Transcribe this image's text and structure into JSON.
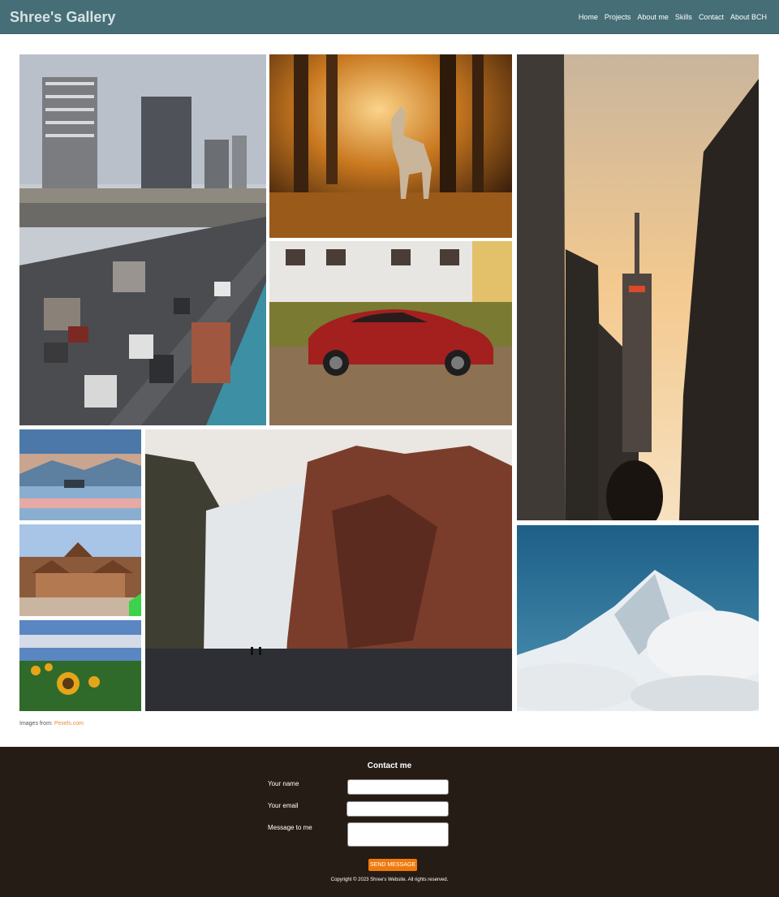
{
  "header": {
    "brand": "Shree's Gallery",
    "nav": [
      "Home",
      "Projects",
      "About me",
      "Skills",
      "Contact",
      "About BCH"
    ]
  },
  "gallery": {
    "images": [
      {
        "subject": "highway-traffic",
        "icon": "city-highway-photo"
      },
      {
        "subject": "horse-forest",
        "icon": "horse-photo"
      },
      {
        "subject": "red-car",
        "icon": "car-photo"
      },
      {
        "subject": "tower-street",
        "icon": "tower-photo"
      },
      {
        "subject": "lake-sunset",
        "icon": "lake-photo"
      },
      {
        "subject": "temples",
        "icon": "temple-photo"
      },
      {
        "subject": "sunflowers",
        "icon": "sunflower-photo"
      },
      {
        "subject": "waterfall",
        "icon": "waterfall-photo"
      },
      {
        "subject": "snowy-mountain",
        "icon": "mountain-photo"
      }
    ],
    "credit_prefix": "Images from:",
    "credit_link": "Pexels.com"
  },
  "footer": {
    "title": "Contact me",
    "name_label": "Your name",
    "email_label": "Your email",
    "message_label": "Message to me",
    "send_label": "SEND MESSAGE",
    "copyright": "Copyright © 2023 Shree's Website. All rights reserved."
  },
  "colors": {
    "header_bg": "#456e76",
    "footer_bg": "#261c16",
    "accent": "#ef7a0c",
    "link": "#e8893a"
  }
}
